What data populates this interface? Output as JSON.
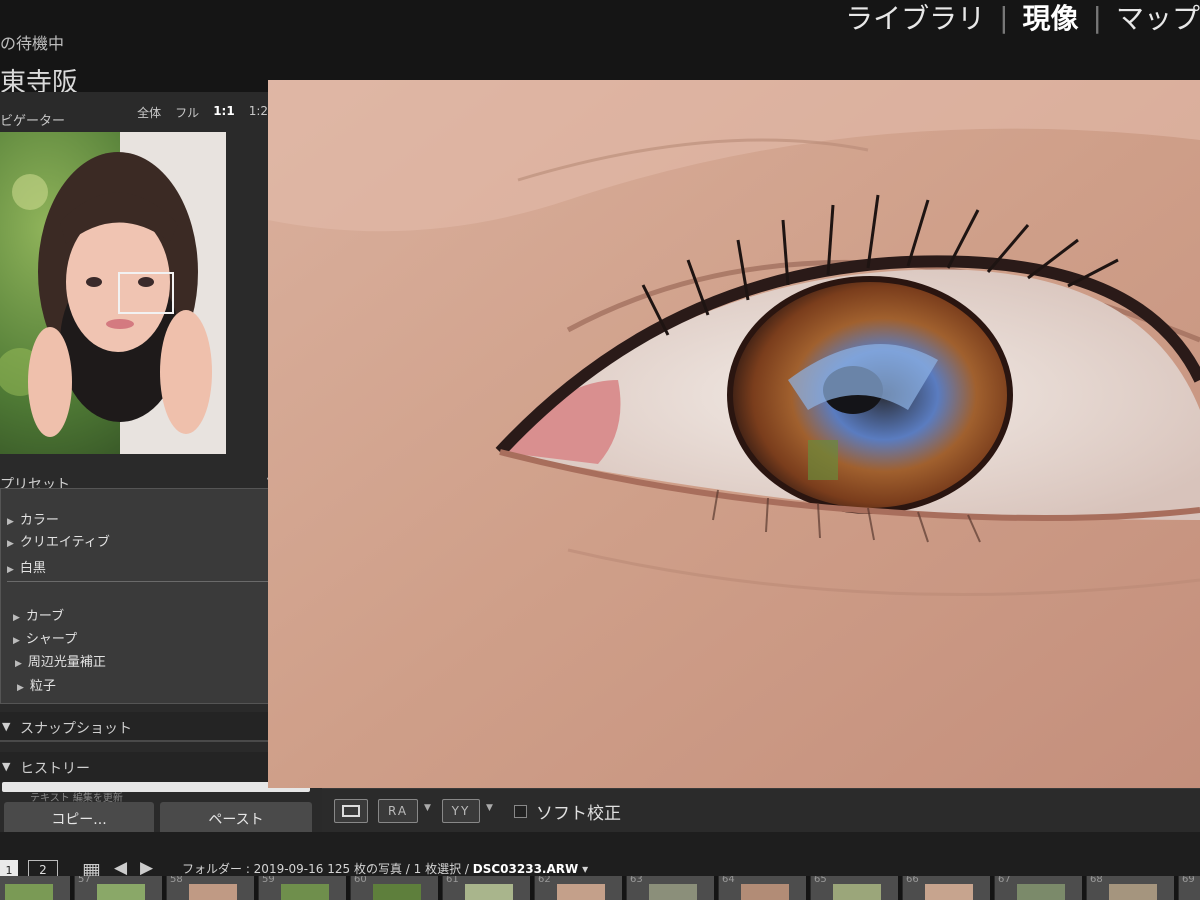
{
  "topbar": {
    "status": "の待機中",
    "catalog": "東寺阪",
    "modules": [
      "ライブラリ",
      "現像",
      "マップ"
    ],
    "active_module": "現像"
  },
  "left_panel": {
    "navigator": {
      "title": "ビゲーター",
      "zoom_options": [
        "全体",
        "フル",
        "1:1",
        "1:2"
      ],
      "zoom_selected": "1:1"
    },
    "presets": {
      "title": "プリセット",
      "add": "+",
      "group1": [
        "カラー",
        "クリエイティブ",
        "白黒"
      ],
      "group2": [
        "カーブ",
        "シャープ",
        "周辺光量補正",
        "粒子"
      ]
    },
    "snapshot": {
      "title": "スナップショット",
      "action": "+"
    },
    "history": {
      "title": "ヒストリー",
      "action": "×",
      "entry": "テキスト 編集を更新"
    },
    "copy_label": "コピー...",
    "paste_label": "ペースト"
  },
  "toolbar": {
    "ra_label": "RA",
    "yy_label": "YY",
    "softproof_label": "ソフト校正"
  },
  "filmstrip": {
    "page1": "1",
    "page2": "2",
    "folder_text": "フォルダー : 2019-09-16   125 枚の写真 / 1 枚選択 /",
    "filename": "DSC03233.ARW",
    "caret": "▾",
    "thumb_numbers": [
      "",
      "57",
      "58",
      "59",
      "60",
      "61",
      "62",
      "63",
      "64",
      "65",
      "66",
      "67",
      "68",
      "69"
    ]
  },
  "colors": {
    "panel": "#2a2a2a",
    "toolbar": "#2b2b2b",
    "skin": "#c8917c"
  },
  "icons": {
    "grid": "grid-icon",
    "prev": "arrow-left-icon",
    "next": "arrow-right-icon"
  }
}
